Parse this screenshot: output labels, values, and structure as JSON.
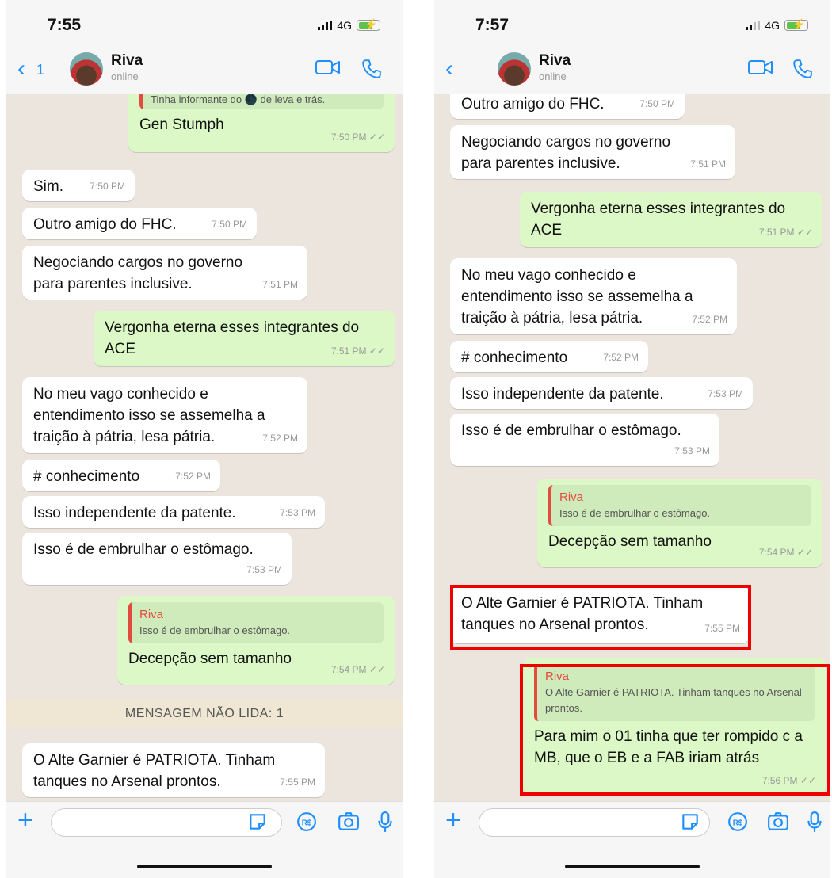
{
  "left": {
    "time": "7:55",
    "network": "4G",
    "back_count": "1",
    "contact": {
      "name": "Riva",
      "status": "online"
    },
    "partial_quote": "Tinha informante do 🌑 de leva e trás.",
    "messages": [
      {
        "text": "Gen Stumph",
        "time": "7:50 PM ✓✓"
      },
      {
        "text": "Sim.",
        "time": "7:50 PM"
      },
      {
        "text": "Outro amigo do FHC.",
        "time": "7:50 PM"
      },
      {
        "text": "Negociando cargos no governo para parentes inclusive.",
        "time": "7:51 PM"
      },
      {
        "text": "Vergonha eterna esses integrantes do ACE",
        "time": "7:51 PM ✓✓"
      },
      {
        "text": "No meu vago conhecido e entendimento isso se assemelha a traição à pátria, lesa pátria.",
        "time": "7:52 PM"
      },
      {
        "text": "# conhecimento",
        "time": "7:52 PM"
      },
      {
        "text": "Isso independente da patente.",
        "time": "7:53 PM"
      },
      {
        "text": "Isso é de embrulhar o estômago.",
        "time": "7:53 PM"
      },
      {
        "quote_name": "Riva",
        "quote_text": "Isso é de embrulhar o estômago.",
        "text": "Decepção sem tamanho",
        "time": "7:54 PM ✓✓"
      },
      {
        "text": "O Alte Garnier é PATRIOTA. Tinham tanques no Arsenal prontos.",
        "time": "7:55 PM"
      }
    ],
    "unread_banner": "MENSAGEM NÃO LIDA: 1"
  },
  "right": {
    "time": "7:57",
    "network": "4G",
    "contact": {
      "name": "Riva",
      "status": "online"
    },
    "messages": [
      {
        "text": "Outro amigo do FHC.",
        "time": "7:50 PM"
      },
      {
        "text": "Negociando cargos no governo para parentes inclusive.",
        "time": "7:51 PM"
      },
      {
        "text": "Vergonha eterna esses integrantes do ACE",
        "time": "7:51 PM ✓✓"
      },
      {
        "text": "No meu vago conhecido e entendimento isso se assemelha a traição à pátria, lesa pátria.",
        "time": "7:52 PM"
      },
      {
        "text": "# conhecimento",
        "time": "7:52 PM"
      },
      {
        "text": "Isso independente da patente.",
        "time": "7:53 PM"
      },
      {
        "text": "Isso é de embrulhar o estômago.",
        "time": "7:53 PM"
      },
      {
        "quote_name": "Riva",
        "quote_text": "Isso é de embrulhar o estômago.",
        "text": "Decepção sem tamanho",
        "time": "7:54 PM ✓✓"
      },
      {
        "text": "O Alte Garnier é PATRIOTA. Tinham tanques no Arsenal prontos.",
        "time": "7:55 PM"
      },
      {
        "quote_name": "Riva",
        "quote_text": "O Alte Garnier é PATRIOTA. Tinham tanques no Arsenal prontos.",
        "text": "Para mim o 01 tinha que ter rompido c a MB, que o EB e a FAB iriam atrás",
        "time": "7:56 PM ✓✓"
      }
    ]
  },
  "colors": {
    "accent": "#1f8fff",
    "incoming": "#ffffff",
    "outgoing": "#dcf8c6",
    "chat_bg": "#ece5dd",
    "highlight": "#e00000",
    "quote_bar": "#e24c3f"
  },
  "icons": [
    "back-chevron-icon",
    "avatar",
    "video-call-icon",
    "phone-call-icon",
    "plus-icon",
    "sticker-icon",
    "payment-icon",
    "camera-icon",
    "microphone-icon",
    "signal-icon",
    "battery-icon"
  ]
}
